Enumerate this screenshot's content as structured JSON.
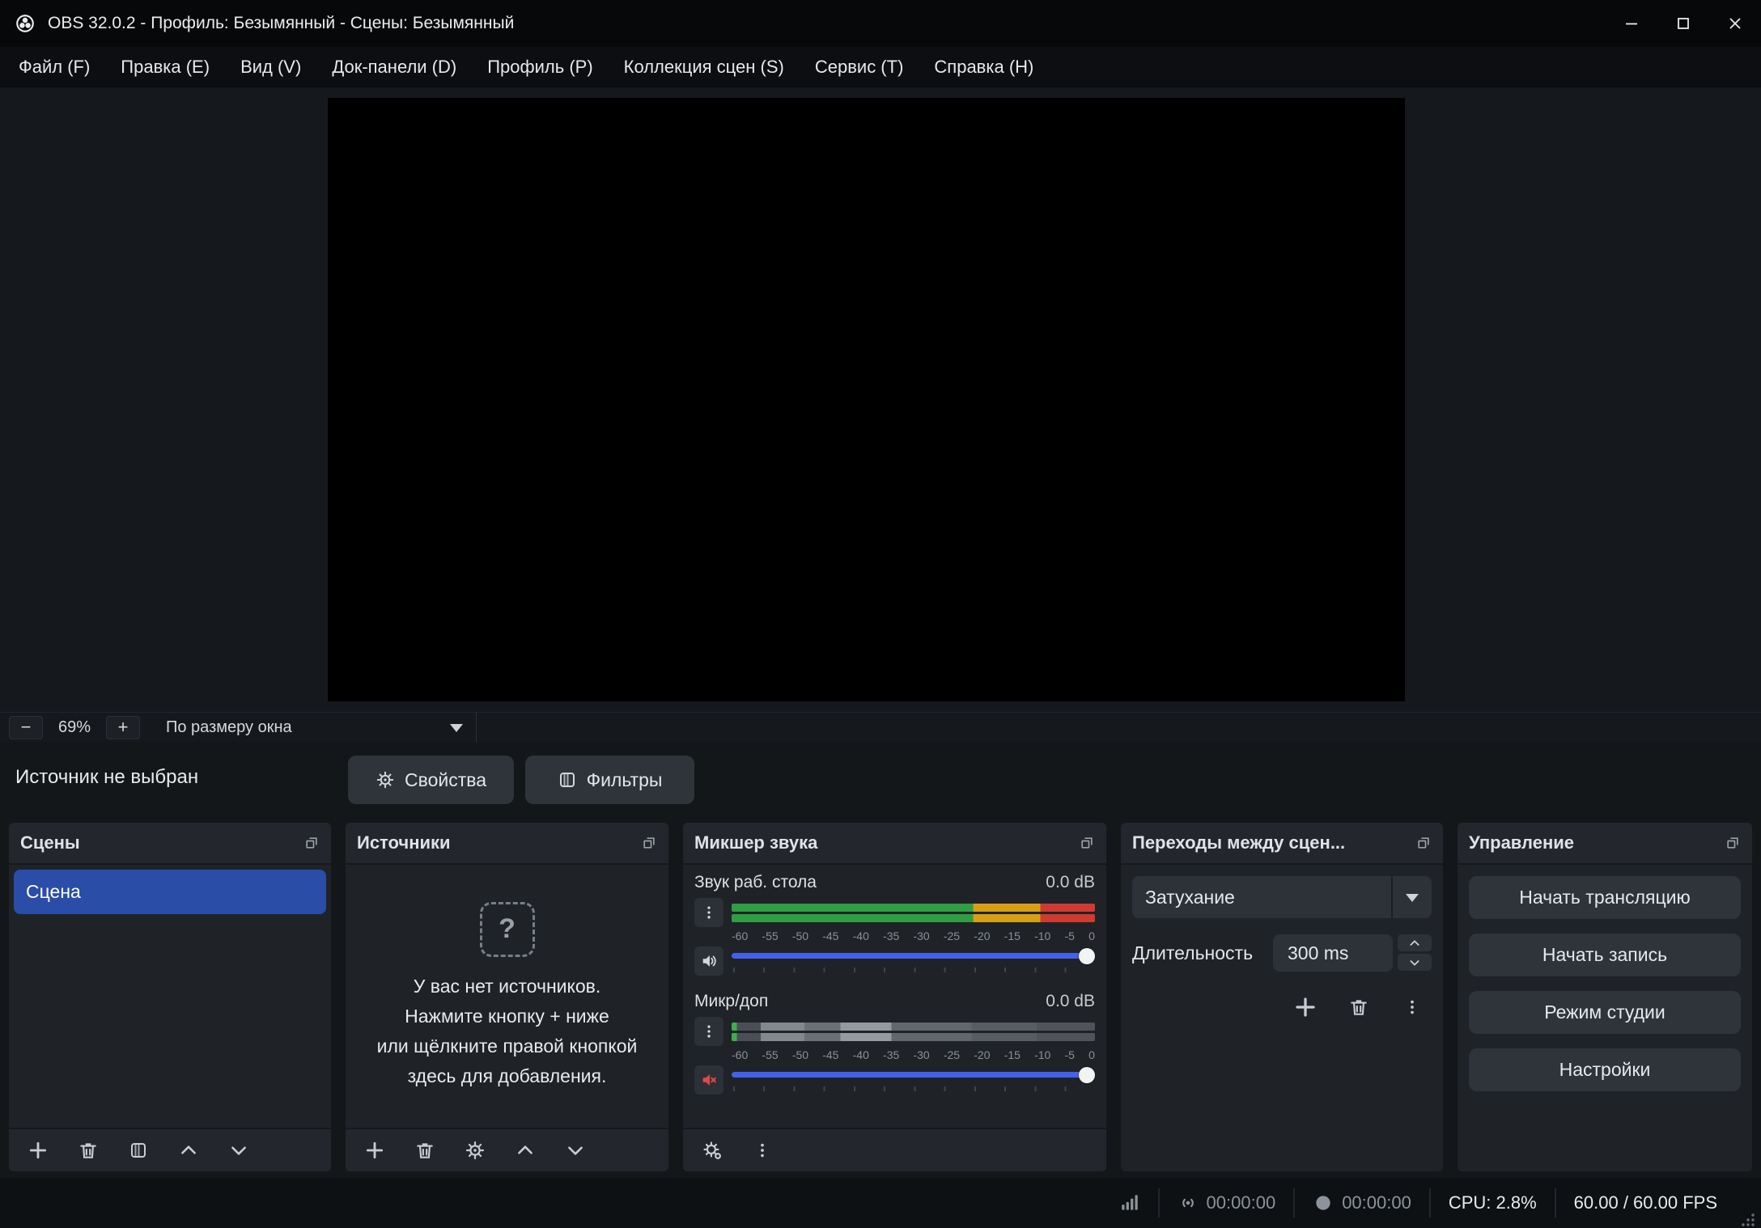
{
  "window": {
    "title": "OBS 32.0.2 - Профиль: Безымянный - Сцены: Безымянный"
  },
  "menu": {
    "items": [
      "Файл (F)",
      "Правка (E)",
      "Вид (V)",
      "Док-панели (D)",
      "Профиль (P)",
      "Коллекция сцен (S)",
      "Сервис (T)",
      "Справка (H)"
    ]
  },
  "preview": {
    "zoom_out": "−",
    "zoom_value": "69%",
    "zoom_in": "+",
    "fit_label": "По размеру окна"
  },
  "source_row": {
    "status": "Источник не выбран",
    "properties_label": "Свойства",
    "filters_label": "Фильтры"
  },
  "scenes": {
    "title": "Сцены",
    "items": [
      {
        "label": "Сцена",
        "selected": true
      }
    ]
  },
  "sources": {
    "title": "Источники",
    "empty_lines": [
      "У вас нет источников.",
      "Нажмите кнопку + ниже",
      "или щёлкните правой кнопкой",
      "здесь для добавления."
    ]
  },
  "mixer": {
    "title": "Микшер звука",
    "ticks": [
      "-60",
      "-55",
      "-50",
      "-45",
      "-40",
      "-35",
      "-30",
      "-25",
      "-20",
      "-15",
      "-10",
      "-5",
      "0"
    ],
    "channels": [
      {
        "name": "Звук раб. стола",
        "db": "0.0 dB",
        "muted": false
      },
      {
        "name": "Микр/доп",
        "db": "0.0 dB",
        "muted": true
      }
    ]
  },
  "transitions": {
    "title": "Переходы между сцен...",
    "selected_transition": "Затухание",
    "duration_label": "Длительность",
    "duration_value": "300 ms"
  },
  "controls": {
    "title": "Управление",
    "buttons": [
      "Начать трансляцию",
      "Начать запись",
      "Режим студии",
      "Настройки"
    ]
  },
  "statusbar": {
    "stream_time": "00:00:00",
    "record_time": "00:00:00",
    "cpu": "CPU: 2.8%",
    "fps": "60.00 / 60.00 FPS"
  },
  "colors": {
    "scene_selected_blue": "#2a4da8",
    "slider_blue": "#4361ee",
    "meter_green": "#2f9e44",
    "meter_yellow": "#d7a014",
    "meter_red": "#cf3b30",
    "mute_red": "#e5484d"
  }
}
